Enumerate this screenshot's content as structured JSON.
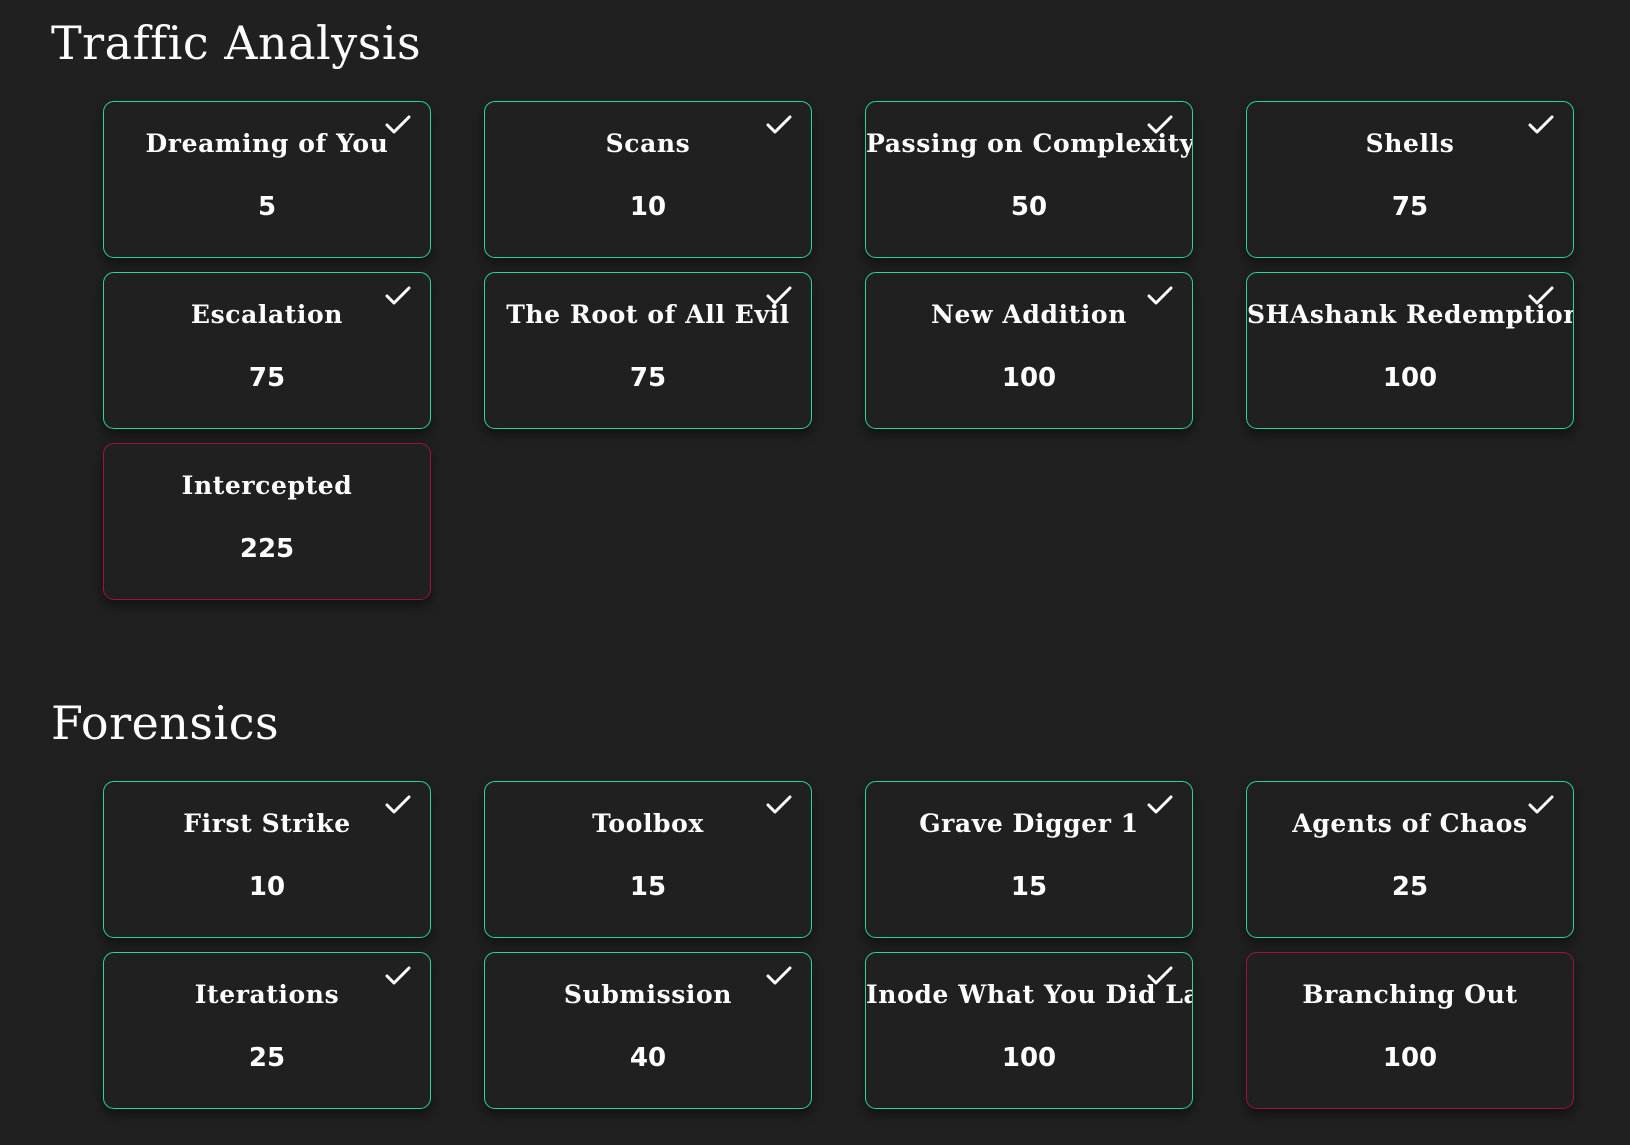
{
  "sections": [
    {
      "title": "Traffic Analysis",
      "challenges": [
        {
          "name": "Dreaming of You",
          "value": "5",
          "solved": true
        },
        {
          "name": "Scans",
          "value": "10",
          "solved": true
        },
        {
          "name": "Passing on Complexity",
          "value": "50",
          "solved": true
        },
        {
          "name": "Shells",
          "value": "75",
          "solved": true
        },
        {
          "name": "Escalation",
          "value": "75",
          "solved": true
        },
        {
          "name": "The Root of All Evil",
          "value": "75",
          "solved": true
        },
        {
          "name": "New Addition",
          "value": "100",
          "solved": true
        },
        {
          "name": "SHAshank Redemption",
          "value": "100",
          "solved": true
        },
        {
          "name": "Intercepted",
          "value": "225",
          "solved": false
        }
      ]
    },
    {
      "title": "Forensics",
      "challenges": [
        {
          "name": "First Strike",
          "value": "10",
          "solved": true
        },
        {
          "name": "Toolbox",
          "value": "15",
          "solved": true
        },
        {
          "name": "Grave Digger 1",
          "value": "15",
          "solved": true
        },
        {
          "name": "Agents of Chaos",
          "value": "25",
          "solved": true
        },
        {
          "name": "Iterations",
          "value": "25",
          "solved": true
        },
        {
          "name": "Submission",
          "value": "40",
          "solved": true
        },
        {
          "name": "Inode What You Did Last Summer",
          "value": "100",
          "solved": true
        },
        {
          "name": "Branching Out",
          "value": "100",
          "solved": false
        }
      ]
    }
  ],
  "icons": {
    "solved": "check-icon"
  },
  "colors": {
    "background": "#202020",
    "solved_border": "#2bd49c",
    "unsolved_border": "#9a1547",
    "text": "#ffffff"
  }
}
